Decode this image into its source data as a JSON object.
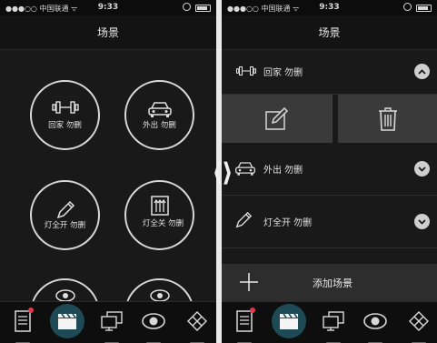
{
  "status_bar": {
    "carrier": "●●●○○ 中国联通 ᯤ",
    "time": "9:33"
  },
  "left_screen": {
    "title": "场景",
    "scenes": [
      {
        "label": "回家 勿删",
        "icon": "dumbbell-icon"
      },
      {
        "label": "外出 勿删",
        "icon": "car-icon"
      },
      {
        "label": "灯全开 勿删",
        "icon": "pen-icon"
      },
      {
        "label": "灯全关 勿删",
        "icon": "box-arrows-icon"
      }
    ]
  },
  "right_screen": {
    "title": "场景",
    "rows": [
      {
        "label": "回家 勿删",
        "icon": "dumbbell-icon",
        "chevron": "up"
      },
      {
        "label": "外出 勿删",
        "icon": "car-icon",
        "chevron": "down"
      },
      {
        "label": "灯全开 勿删",
        "icon": "pen-icon",
        "chevron": "down"
      }
    ],
    "actions": [
      "edit-icon",
      "trash-icon"
    ],
    "add_scene_label": "添加场景"
  },
  "tabbar": {
    "tabs": [
      "document-icon",
      "clapperboard-icon",
      "monitors-icon",
      "eye-icon",
      "diamond-grid-icon"
    ],
    "active_index": 1
  },
  "colors": {
    "background": "#191919",
    "accent": "#1e4a56",
    "badge": "#e0394a"
  }
}
